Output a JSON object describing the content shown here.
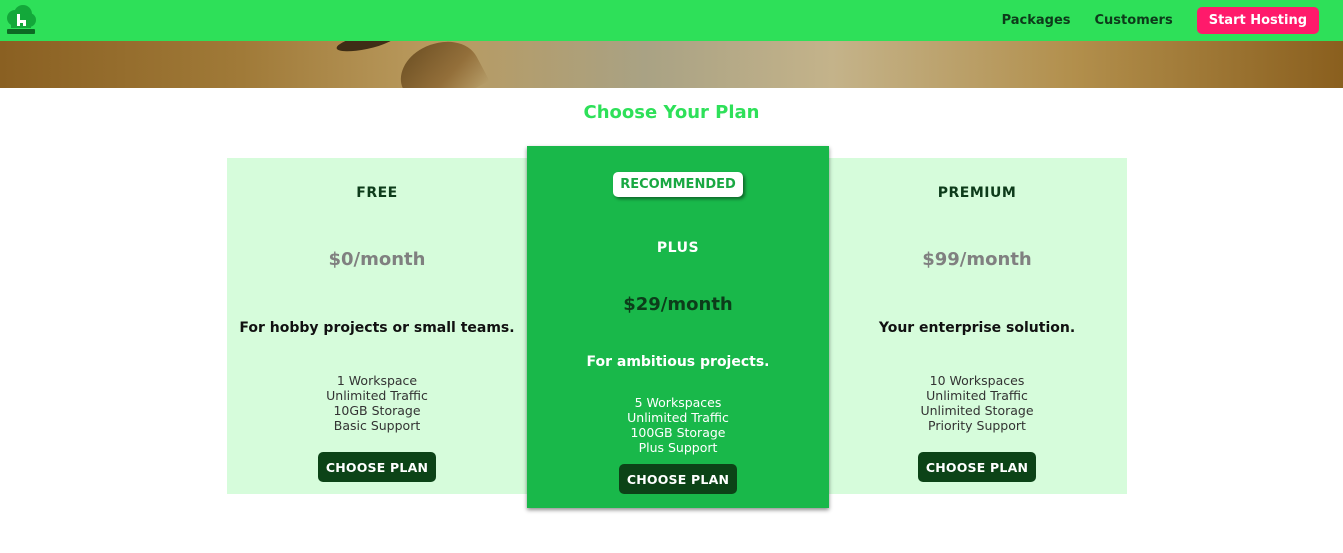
{
  "header": {
    "logo_icon": "cloud-h-logo-icon",
    "nav": [
      {
        "label": "Packages"
      },
      {
        "label": "Customers"
      }
    ],
    "cta_label": "Start Hosting"
  },
  "section": {
    "title": "Choose Your Plan"
  },
  "plans": [
    {
      "name": "FREE",
      "price": "$0/month",
      "tagline": "For hobby projects or small teams.",
      "features": [
        "1 Workspace",
        "Unlimited Traffic",
        "10GB Storage",
        "Basic Support"
      ],
      "button": "CHOOSE PLAN"
    },
    {
      "badge": "RECOMMENDED",
      "name": "PLUS",
      "price": "$29/month",
      "tagline": "For ambitious projects.",
      "features": [
        "5 Workspaces",
        "Unlimited Traffic",
        "100GB Storage",
        "Plus Support"
      ],
      "button": "CHOOSE PLAN"
    },
    {
      "name": "PREMIUM",
      "price": "$99/month",
      "tagline": "Your enterprise solution.",
      "features": [
        "10 Workspaces",
        "Unlimited Traffic",
        "Unlimited Storage",
        "Priority Support"
      ],
      "button": "CHOOSE PLAN"
    }
  ],
  "colors": {
    "header_bg": "#2ee059",
    "accent_pink": "#ff1a6b",
    "plan_band_bg": "#d6fcdb",
    "recommended_bg": "#19b84a",
    "button_bg": "#0c4317"
  }
}
